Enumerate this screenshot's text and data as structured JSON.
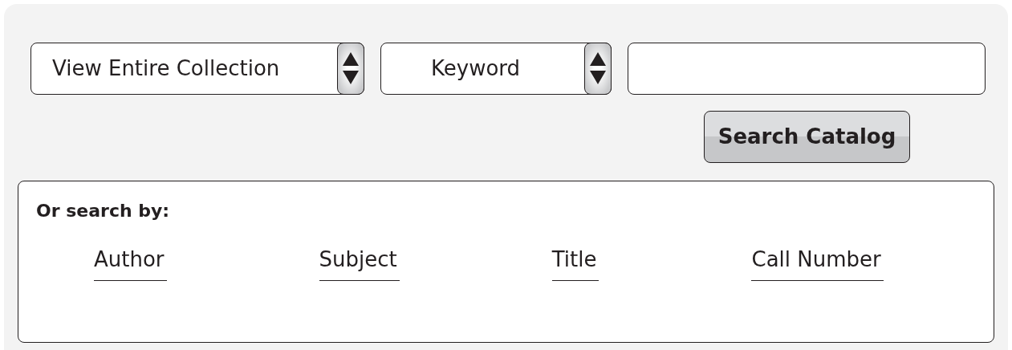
{
  "scope_select": {
    "value": "View Entire Collection"
  },
  "type_select": {
    "value": "Keyword"
  },
  "search_button": {
    "label": "Search Catalog"
  },
  "browse": {
    "heading": "Or search by:",
    "links": [
      {
        "label": "Author"
      },
      {
        "label": "Subject"
      },
      {
        "label": "Title"
      },
      {
        "label": "Call Number"
      }
    ]
  }
}
